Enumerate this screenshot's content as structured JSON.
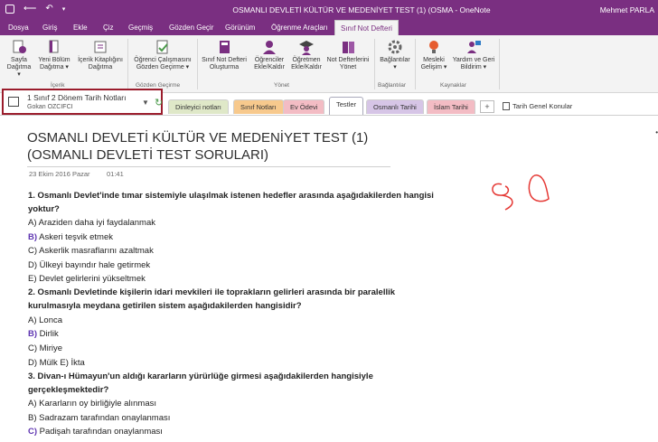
{
  "window": {
    "title": "OSMANLI DEVLETİ KÜLTÜR VE MEDENİYET TEST (1) (OSMA  -  OneNote",
    "user": "Mehmet PARLA"
  },
  "menu": {
    "tabs": [
      "Dosya",
      "Giriş",
      "Ekle",
      "Çiz",
      "Geçmiş",
      "Gözden Geçir",
      "Görünüm",
      "Öğrenme Araçları",
      "Sınıf Not Defteri"
    ],
    "active": "Sınıf Not Defteri"
  },
  "ribbon": {
    "buttons": [
      {
        "label": "Sayfa",
        "label2": "Dağıtma ▾",
        "icon": "page-distribute-icon"
      },
      {
        "label": "Yeni Bölüm",
        "label2": "Dağıtma ▾",
        "icon": "section-distribute-icon"
      },
      {
        "label": "İçerik Kitaplığını",
        "label2": "Dağıtma",
        "icon": "content-library-icon"
      },
      {
        "label": "Öğrenci Çalışmasını",
        "label2": "Gözden Geçirme ▾",
        "icon": "review-work-icon"
      },
      {
        "label": "Sınıf Not Defteri",
        "label2": "Oluşturma",
        "icon": "create-notebook-icon"
      },
      {
        "label": "Öğrenciler",
        "label2": "Ekle/Kaldır",
        "icon": "students-icon"
      },
      {
        "label": "Öğretmen",
        "label2": "Ekle/Kaldır",
        "icon": "teacher-icon"
      },
      {
        "label": "Not Defterlerini",
        "label2": "Yönet",
        "icon": "manage-notebooks-icon"
      },
      {
        "label": "Bağlantılar",
        "label2": "▾",
        "icon": "gear-icon"
      },
      {
        "label": "Mesleki",
        "label2": "Gelişim ▾",
        "icon": "lightbulb-icon"
      },
      {
        "label": "Yardım ve Geri",
        "label2": "Bildirim ▾",
        "icon": "help-feedback-icon"
      }
    ],
    "groups": [
      "İçerik",
      "Gözden Geçirme",
      "Yönet",
      "Bağlantılar",
      "Kaynaklar"
    ]
  },
  "notebook": {
    "name": "1 Sınıf 2 Dönem Tarih Notları",
    "owner": "Gokan OZCIFCI"
  },
  "sections": {
    "tabs": [
      "Dinleyici notları",
      "Sınıf Notları",
      "Ev Ödevi",
      "Testler",
      "Osmanlı Tarihi",
      "İslam Tarihi"
    ],
    "active": "Testler",
    "add": "+",
    "group": "Tarih Genel Konular"
  },
  "page": {
    "title_line1": "OSMANLI DEVLETİ KÜLTÜR VE MEDENİYET TEST (1)",
    "title_line2": "(OSMANLI DEVLETİ TEST SORULARI)",
    "date": "23 Ekim 2016 Pazar",
    "time": "01:41",
    "lines": [
      {
        "text": "1. Osmanlı Devlet'inde tımar sistemiyle ulaşılmak istenen hedefler arasında aşağıdakilerden hangisi",
        "bold": true
      },
      {
        "text": "yoktur?",
        "bold": true
      },
      {
        "text": "A) Araziden daha iyi faydalanmak"
      },
      {
        "lead": "B)",
        "text": " Askeri teşvik etmek"
      },
      {
        "text": "C) Askerlik masraflarını azaltmak"
      },
      {
        "text": "D) Ülkeyi bayındır hale getirmek"
      },
      {
        "text": "E) Devlet gelirlerini yükseltmek"
      },
      {
        "text": "2. Osmanlı Devletinde kişilerin idari mevkileri ile toprakların gelirleri arasında bir paralellik",
        "bold": true
      },
      {
        "text": "kurulmasıyla meydana getirilen sistem aşağıdakilerden hangisidir?",
        "bold": true
      },
      {
        "text": "A) Lonca"
      },
      {
        "lead": "B)",
        "text": " Dirlik"
      },
      {
        "text": "C) Miriye"
      },
      {
        "text": "D) Mülk E) İkta"
      },
      {
        "text": "3. Divan-ı Hümayun'un aldığı kararların yürürlüğe girmesi aşağıdakilerden hangisiyle",
        "bold": true
      },
      {
        "text": "gerçekleşmektedir?",
        "bold": true
      },
      {
        "text": "A) Kararların oy birliğiyle alınması"
      },
      {
        "text": "B) Sadrazam tarafından onaylanması"
      },
      {
        "lead": "C)",
        "text": " Padişah tarafından onaylanması"
      }
    ]
  },
  "colors": {
    "brand": "#7a2f81",
    "highlight_border": "#9b1c2c",
    "answer": "#5e35b1",
    "ink": "#e53935"
  }
}
